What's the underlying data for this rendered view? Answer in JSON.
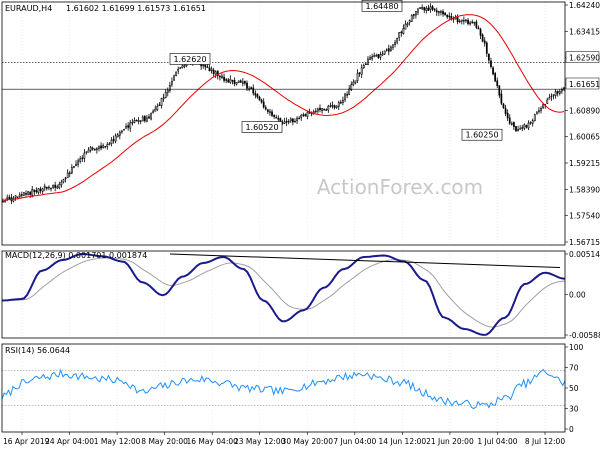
{
  "header": {
    "symbol_tf": "EURAUD,H4",
    "ohlc": "1.61602 1.61699 1.61573 1.61651"
  },
  "watermark": "ActionForex.com",
  "colors": {
    "candle": "#000000",
    "moving_average": "#ee0000",
    "hline": "#000000",
    "macd_main": "#1a1a8c",
    "macd_signal": "#a0a0a0",
    "macd_trendline": "#000000",
    "rsi": "#1e90ff",
    "grid": "#000000",
    "label_bg": "#ffffff"
  },
  "chart_data": [
    {
      "type": "candlestick",
      "title": "EURAUD,H4",
      "ylim": [
        1.562,
        1.647
      ],
      "y_ticks": [
        "1.64240",
        "1.63415",
        "1.62590",
        "1.61651",
        "1.60890",
        "1.60065",
        "1.59215",
        "1.58390",
        "1.57540",
        "1.56715"
      ],
      "x_ticks": [
        "16 Apr 2019",
        "24 Apr 04:00",
        "1 May 12:00",
        "8 May 20:00",
        "16 May 04:00",
        "23 May 12:00",
        "30 May 20:00",
        "7 Jun 04:00",
        "14 Jun 12:00",
        "21 Jun 20:00",
        "1 Jul 04:00",
        "8 Jul 12:00"
      ],
      "annotations": [
        "1.62620",
        "1.60520",
        "1.64480",
        "1.60250"
      ],
      "hlines": [
        1.6259,
        1.61651
      ],
      "overlay": "moving average",
      "key_points": [
        {
          "x": "16 Apr 2019",
          "close": 1.5778
        },
        {
          "x": "24 Apr 04:00",
          "close": 1.582
        },
        {
          "x": "1 May 12:00",
          "close": 1.596
        },
        {
          "x": "8 May 20:00",
          "close": 1.606
        },
        {
          "x": "13 May",
          "close": 1.6262
        },
        {
          "x": "16 May 04:00",
          "close": 1.619
        },
        {
          "x": "27 May",
          "close": 1.6052
        },
        {
          "x": "30 May 20:00",
          "close": 1.61
        },
        {
          "x": "7 Jun 04:00",
          "close": 1.628
        },
        {
          "x": "13 Jun",
          "close": 1.6448
        },
        {
          "x": "21 Jun 20:00",
          "close": 1.64
        },
        {
          "x": "1 Jul 04:00",
          "close": 1.6025
        },
        {
          "x": "8 Jul 12:00",
          "close": 1.6165
        }
      ]
    },
    {
      "type": "line",
      "title": "MACD(12,26,9) 0.001701 0.001874",
      "ylim": [
        -0.0062,
        0.0054
      ],
      "y_ticks": [
        "0.005149",
        "0.00",
        "-0.005887"
      ],
      "series": [
        {
          "name": "MACD",
          "values": [
            -0.0012,
            -0.001,
            0.0028,
            0.0042,
            0.005,
            0.0047,
            0.004,
            0.0012,
            -0.0005,
            0.002,
            0.0038,
            0.0046,
            0.003,
            -0.0012,
            -0.004,
            -0.0025,
            0.0005,
            0.003,
            0.0046,
            0.0048,
            0.004,
            0.0015,
            -0.0035,
            -0.005,
            -0.0058,
            -0.0035,
            0.001,
            0.0025,
            0.0017
          ]
        }
      ],
      "trendline": "upper trendline across MACD peaks"
    },
    {
      "type": "line",
      "title": "RSI(14) 56.0644",
      "ylim": [
        0,
        100
      ],
      "y_ticks": [
        "100",
        "70",
        "50",
        "30",
        "0"
      ],
      "levels": [
        70,
        30
      ],
      "series": [
        {
          "name": "RSI(14)",
          "values": [
            40,
            55,
            62,
            66,
            63,
            60,
            58,
            45,
            52,
            58,
            60,
            56,
            50,
            48,
            46,
            52,
            58,
            63,
            66,
            60,
            56,
            44,
            35,
            32,
            30,
            38,
            55,
            68,
            56
          ]
        }
      ]
    }
  ]
}
